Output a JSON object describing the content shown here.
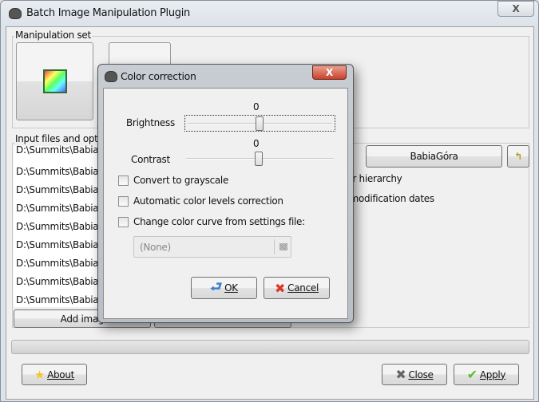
{
  "window": {
    "title": "Batch Image Manipulation Plugin",
    "close_label": "X"
  },
  "manipulation_set": {
    "label": "Manipulation set"
  },
  "input_files": {
    "label": "Input files and optio",
    "files": [
      "D:\\Summits\\BabiaG",
      "D:\\Summits\\BabiaG",
      "D:\\Summits\\BabiaG",
      "D:\\Summits\\BabiaG",
      "D:\\Summits\\BabiaG",
      "D:\\Summits\\BabiaG",
      "D:\\Summits\\BabiaG",
      "D:\\Summits\\BabiaG",
      "D:\\Summits\\BabiaG"
    ],
    "add_images_label": "Add imag"
  },
  "output": {
    "folder_label_partial": "er",
    "folder_button": "BabiaGóra",
    "hierarchy_partial": "der hierarchy",
    "dates_partial": "e modification dates"
  },
  "progress": {
    "value": 0
  },
  "buttons": {
    "about": "About",
    "close": "Close",
    "apply": "Apply"
  },
  "dialog": {
    "title": "Color correction",
    "close_label": "X",
    "brightness": {
      "label": "Brightness",
      "value": "0",
      "range": [
        -127,
        127
      ]
    },
    "contrast": {
      "label": "Contrast",
      "value": "0",
      "range": [
        -127,
        127
      ]
    },
    "grayscale": {
      "label": "Convert to grayscale",
      "checked": false
    },
    "levels": {
      "label": "Automatic color levels correction",
      "checked": false
    },
    "curve": {
      "label": "Change color curve from settings file:",
      "checked": false
    },
    "curve_file": "(None)",
    "ok": "OK",
    "cancel": "Cancel"
  },
  "colors": {
    "dialog_close": "#c8412b",
    "apply_check": "#5bbd2a",
    "ok_arrow": "#3d7fd0"
  }
}
